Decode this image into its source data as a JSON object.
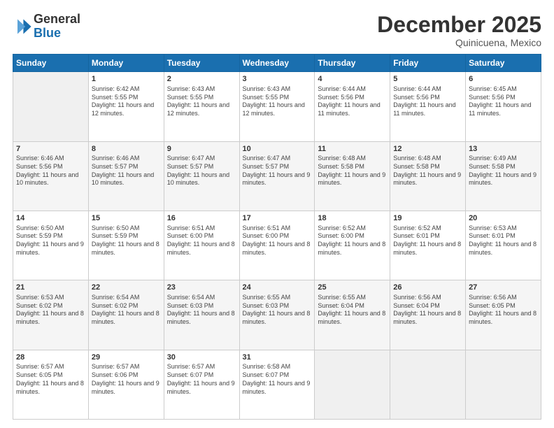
{
  "header": {
    "logo_line1": "General",
    "logo_line2": "Blue",
    "month": "December 2025",
    "location": "Quinicuena, Mexico"
  },
  "days_of_week": [
    "Sunday",
    "Monday",
    "Tuesday",
    "Wednesday",
    "Thursday",
    "Friday",
    "Saturday"
  ],
  "weeks": [
    [
      {
        "day": "",
        "sunrise": "",
        "sunset": "",
        "daylight": ""
      },
      {
        "day": "1",
        "sunrise": "Sunrise: 6:42 AM",
        "sunset": "Sunset: 5:55 PM",
        "daylight": "Daylight: 11 hours and 12 minutes."
      },
      {
        "day": "2",
        "sunrise": "Sunrise: 6:43 AM",
        "sunset": "Sunset: 5:55 PM",
        "daylight": "Daylight: 11 hours and 12 minutes."
      },
      {
        "day": "3",
        "sunrise": "Sunrise: 6:43 AM",
        "sunset": "Sunset: 5:55 PM",
        "daylight": "Daylight: 11 hours and 12 minutes."
      },
      {
        "day": "4",
        "sunrise": "Sunrise: 6:44 AM",
        "sunset": "Sunset: 5:56 PM",
        "daylight": "Daylight: 11 hours and 11 minutes."
      },
      {
        "day": "5",
        "sunrise": "Sunrise: 6:44 AM",
        "sunset": "Sunset: 5:56 PM",
        "daylight": "Daylight: 11 hours and 11 minutes."
      },
      {
        "day": "6",
        "sunrise": "Sunrise: 6:45 AM",
        "sunset": "Sunset: 5:56 PM",
        "daylight": "Daylight: 11 hours and 11 minutes."
      }
    ],
    [
      {
        "day": "7",
        "sunrise": "Sunrise: 6:46 AM",
        "sunset": "Sunset: 5:56 PM",
        "daylight": "Daylight: 11 hours and 10 minutes."
      },
      {
        "day": "8",
        "sunrise": "Sunrise: 6:46 AM",
        "sunset": "Sunset: 5:57 PM",
        "daylight": "Daylight: 11 hours and 10 minutes."
      },
      {
        "day": "9",
        "sunrise": "Sunrise: 6:47 AM",
        "sunset": "Sunset: 5:57 PM",
        "daylight": "Daylight: 11 hours and 10 minutes."
      },
      {
        "day": "10",
        "sunrise": "Sunrise: 6:47 AM",
        "sunset": "Sunset: 5:57 PM",
        "daylight": "Daylight: 11 hours and 9 minutes."
      },
      {
        "day": "11",
        "sunrise": "Sunrise: 6:48 AM",
        "sunset": "Sunset: 5:58 PM",
        "daylight": "Daylight: 11 hours and 9 minutes."
      },
      {
        "day": "12",
        "sunrise": "Sunrise: 6:48 AM",
        "sunset": "Sunset: 5:58 PM",
        "daylight": "Daylight: 11 hours and 9 minutes."
      },
      {
        "day": "13",
        "sunrise": "Sunrise: 6:49 AM",
        "sunset": "Sunset: 5:58 PM",
        "daylight": "Daylight: 11 hours and 9 minutes."
      }
    ],
    [
      {
        "day": "14",
        "sunrise": "Sunrise: 6:50 AM",
        "sunset": "Sunset: 5:59 PM",
        "daylight": "Daylight: 11 hours and 9 minutes."
      },
      {
        "day": "15",
        "sunrise": "Sunrise: 6:50 AM",
        "sunset": "Sunset: 5:59 PM",
        "daylight": "Daylight: 11 hours and 8 minutes."
      },
      {
        "day": "16",
        "sunrise": "Sunrise: 6:51 AM",
        "sunset": "Sunset: 6:00 PM",
        "daylight": "Daylight: 11 hours and 8 minutes."
      },
      {
        "day": "17",
        "sunrise": "Sunrise: 6:51 AM",
        "sunset": "Sunset: 6:00 PM",
        "daylight": "Daylight: 11 hours and 8 minutes."
      },
      {
        "day": "18",
        "sunrise": "Sunrise: 6:52 AM",
        "sunset": "Sunset: 6:00 PM",
        "daylight": "Daylight: 11 hours and 8 minutes."
      },
      {
        "day": "19",
        "sunrise": "Sunrise: 6:52 AM",
        "sunset": "Sunset: 6:01 PM",
        "daylight": "Daylight: 11 hours and 8 minutes."
      },
      {
        "day": "20",
        "sunrise": "Sunrise: 6:53 AM",
        "sunset": "Sunset: 6:01 PM",
        "daylight": "Daylight: 11 hours and 8 minutes."
      }
    ],
    [
      {
        "day": "21",
        "sunrise": "Sunrise: 6:53 AM",
        "sunset": "Sunset: 6:02 PM",
        "daylight": "Daylight: 11 hours and 8 minutes."
      },
      {
        "day": "22",
        "sunrise": "Sunrise: 6:54 AM",
        "sunset": "Sunset: 6:02 PM",
        "daylight": "Daylight: 11 hours and 8 minutes."
      },
      {
        "day": "23",
        "sunrise": "Sunrise: 6:54 AM",
        "sunset": "Sunset: 6:03 PM",
        "daylight": "Daylight: 11 hours and 8 minutes."
      },
      {
        "day": "24",
        "sunrise": "Sunrise: 6:55 AM",
        "sunset": "Sunset: 6:03 PM",
        "daylight": "Daylight: 11 hours and 8 minutes."
      },
      {
        "day": "25",
        "sunrise": "Sunrise: 6:55 AM",
        "sunset": "Sunset: 6:04 PM",
        "daylight": "Daylight: 11 hours and 8 minutes."
      },
      {
        "day": "26",
        "sunrise": "Sunrise: 6:56 AM",
        "sunset": "Sunset: 6:04 PM",
        "daylight": "Daylight: 11 hours and 8 minutes."
      },
      {
        "day": "27",
        "sunrise": "Sunrise: 6:56 AM",
        "sunset": "Sunset: 6:05 PM",
        "daylight": "Daylight: 11 hours and 8 minutes."
      }
    ],
    [
      {
        "day": "28",
        "sunrise": "Sunrise: 6:57 AM",
        "sunset": "Sunset: 6:05 PM",
        "daylight": "Daylight: 11 hours and 8 minutes."
      },
      {
        "day": "29",
        "sunrise": "Sunrise: 6:57 AM",
        "sunset": "Sunset: 6:06 PM",
        "daylight": "Daylight: 11 hours and 9 minutes."
      },
      {
        "day": "30",
        "sunrise": "Sunrise: 6:57 AM",
        "sunset": "Sunset: 6:07 PM",
        "daylight": "Daylight: 11 hours and 9 minutes."
      },
      {
        "day": "31",
        "sunrise": "Sunrise: 6:58 AM",
        "sunset": "Sunset: 6:07 PM",
        "daylight": "Daylight: 11 hours and 9 minutes."
      },
      {
        "day": "",
        "sunrise": "",
        "sunset": "",
        "daylight": ""
      },
      {
        "day": "",
        "sunrise": "",
        "sunset": "",
        "daylight": ""
      },
      {
        "day": "",
        "sunrise": "",
        "sunset": "",
        "daylight": ""
      }
    ]
  ]
}
